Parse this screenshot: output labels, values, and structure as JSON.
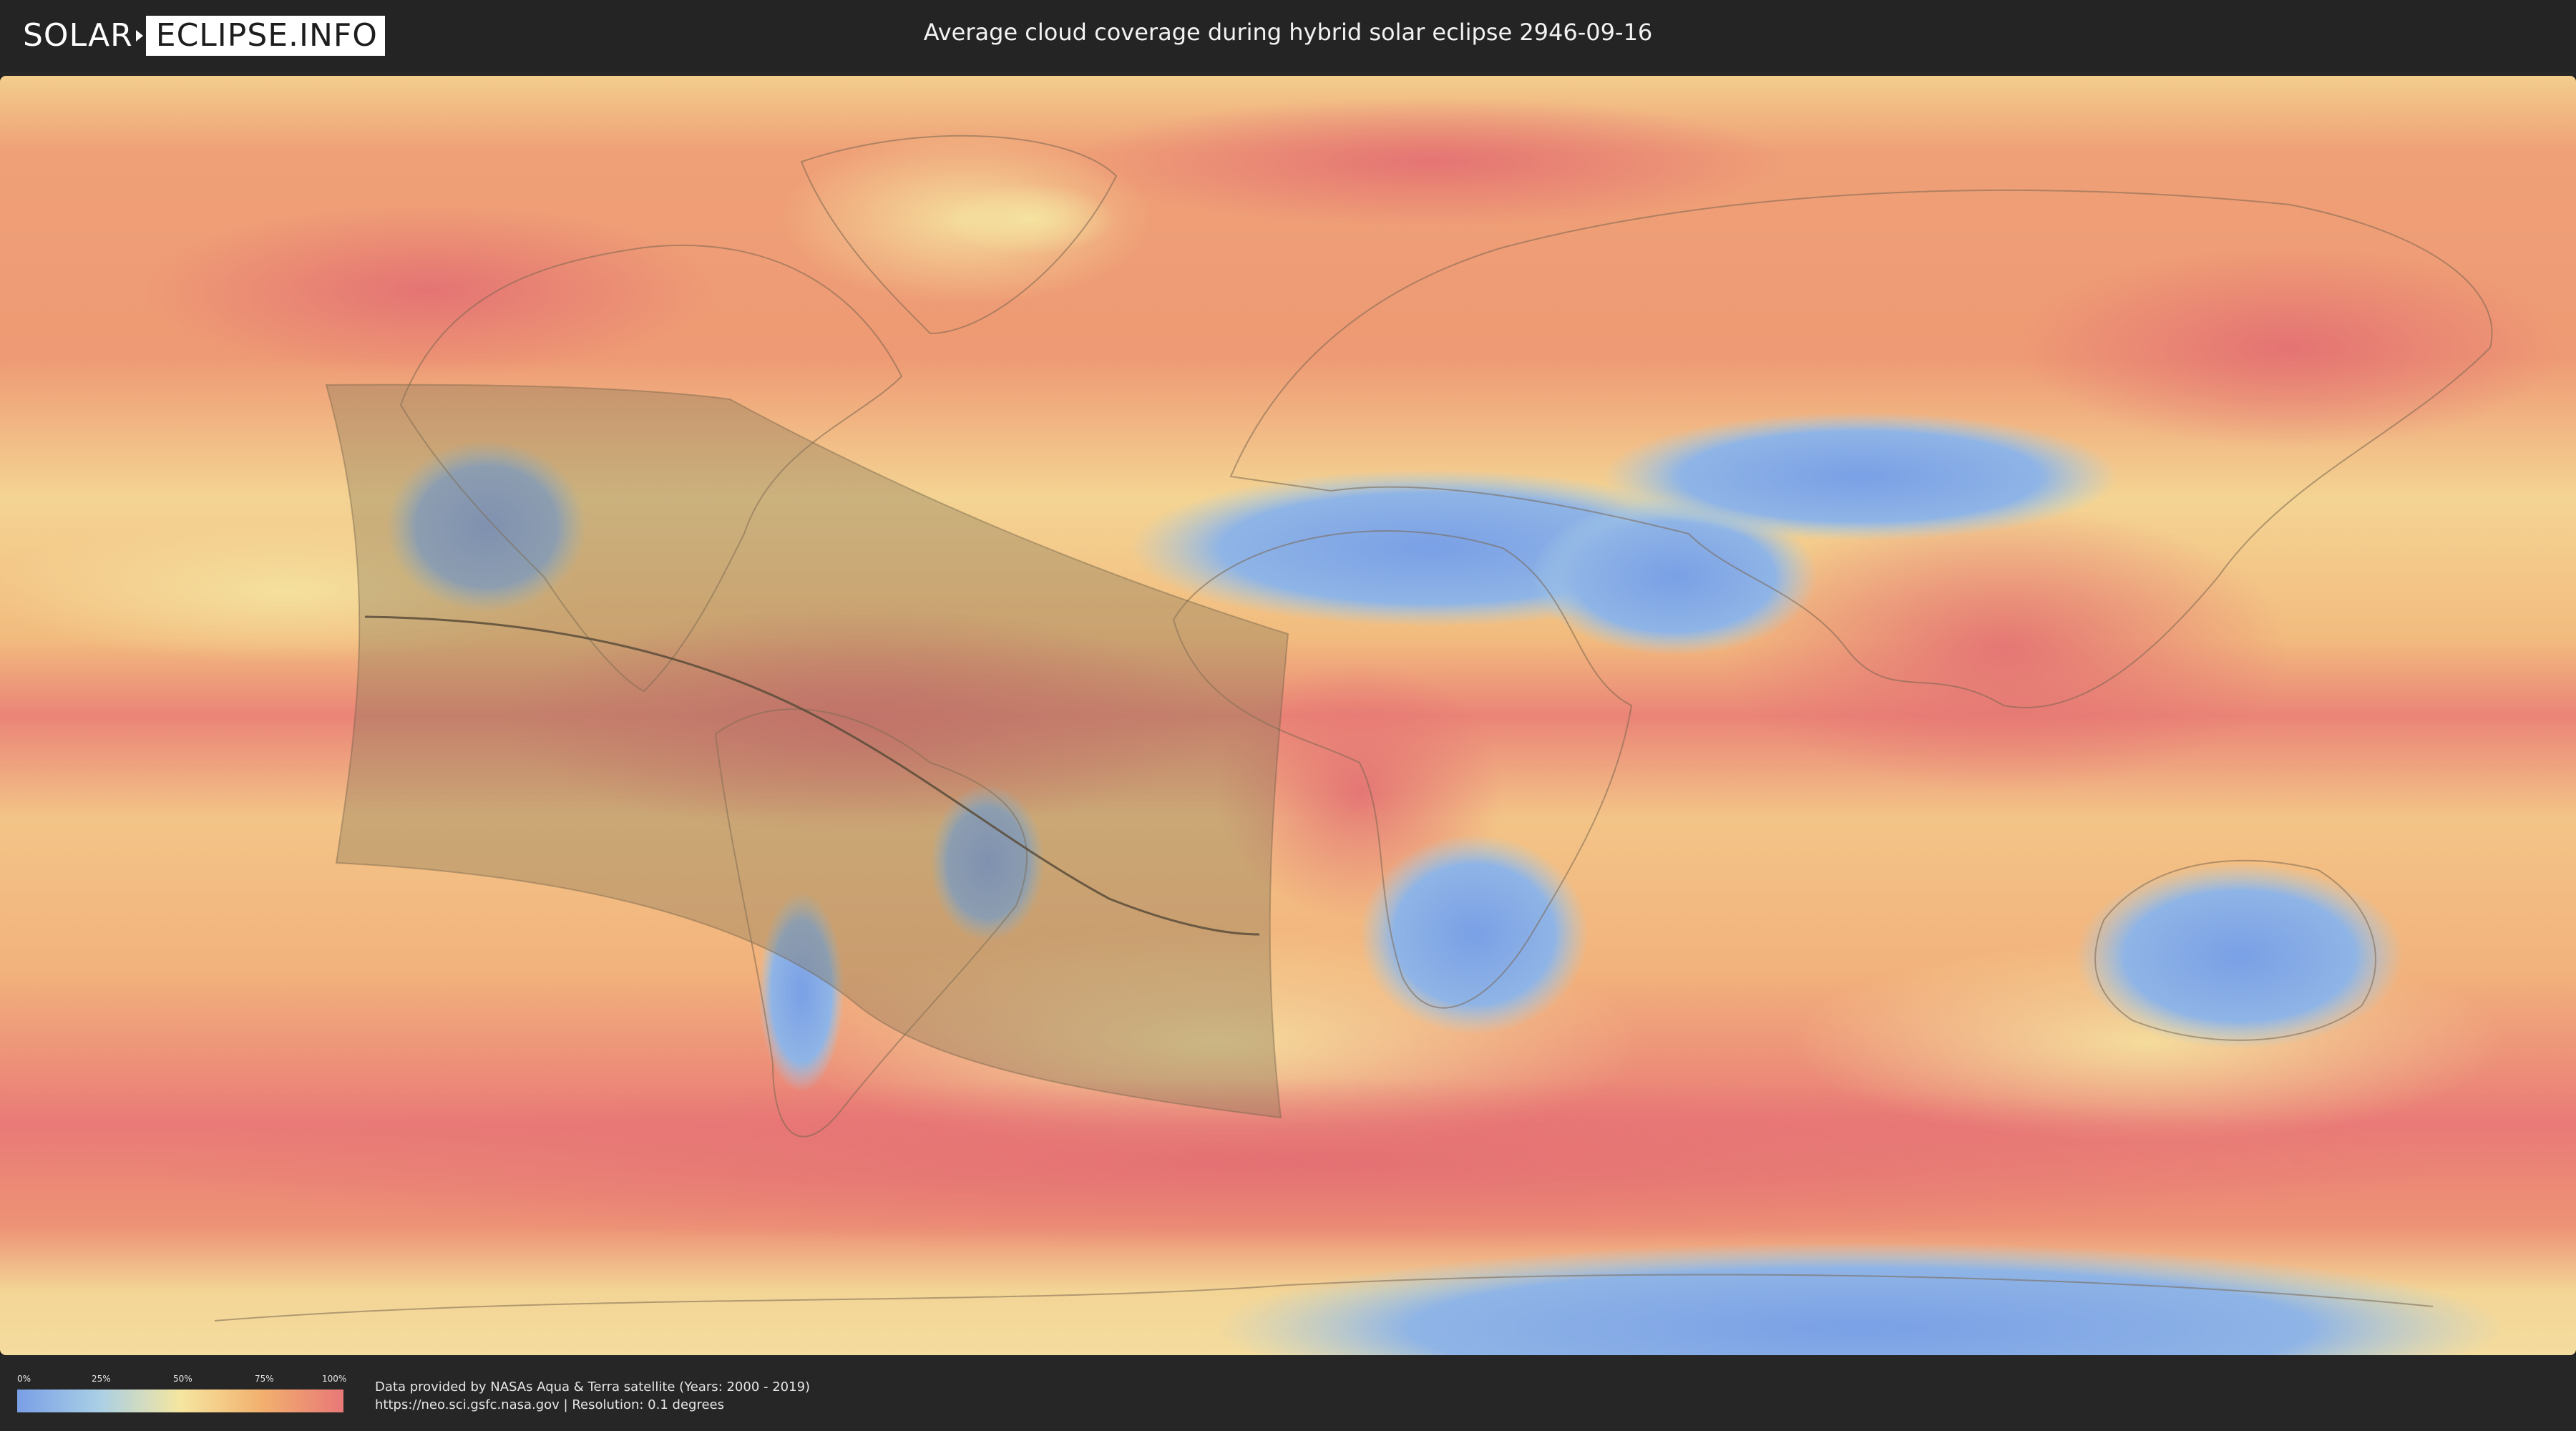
{
  "header": {
    "logo_left": "SOLAR",
    "logo_right": "ECLIPSE.INFO",
    "title": "Average cloud coverage during hybrid solar eclipse 2946-09-16"
  },
  "legend": {
    "ticks": [
      "0%",
      "25%",
      "50%",
      "75%",
      "100%"
    ],
    "colors": [
      "#7a9fe6",
      "#a9cfe6",
      "#f5e6a0",
      "#f2b06e",
      "#e87878"
    ]
  },
  "credits": {
    "line1": "Data provided by NASAs Aqua & Terra satellite (Years: 2000 - 2019)",
    "line2": "https://neo.sci.gsfc.nasa.gov | Resolution: 0.1 degrees"
  },
  "map": {
    "projection": "equirectangular",
    "layers": [
      "cloud-coverage",
      "country-borders",
      "eclipse-shadow-area",
      "central-line"
    ],
    "colors": {
      "ocean_base": "#f2b37a",
      "high_cloud": "#e8787a",
      "clear_sky": "#7ea5e8",
      "shadow_overlay": "#8a7a5a"
    }
  }
}
